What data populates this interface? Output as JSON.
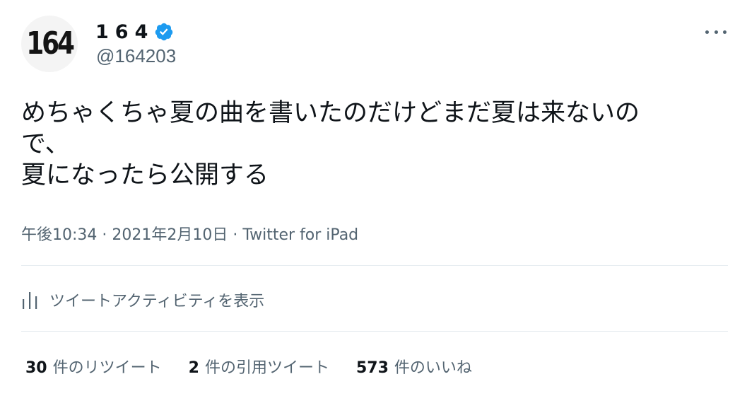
{
  "author": {
    "avatar_text": "164",
    "display_name": "164",
    "handle": "@164203",
    "verified": true
  },
  "tweet": {
    "lines": [
      "めちゃくちゃ夏の曲を書いたのだけどまだ夏は来ないの",
      "で、",
      "夏になったら公開する"
    ]
  },
  "meta": {
    "timestamp": "午後10:34 · 2021年2月10日 · Twitter for iPad"
  },
  "activity": {
    "label": "ツイートアクティビティを表示"
  },
  "stats": [
    {
      "count": "30",
      "label": "件のリツイート"
    },
    {
      "count": "2",
      "label": "件の引用ツイート"
    },
    {
      "count": "573",
      "label": "件のいいね"
    }
  ],
  "colors": {
    "text_primary": "#0f1419",
    "text_secondary": "#536471",
    "verified_blue": "#1d9bf0",
    "divider": "#e6ecf0"
  },
  "icons": {
    "verified": "verified-badge-icon",
    "more": "more-icon",
    "activity": "analytics-icon"
  }
}
